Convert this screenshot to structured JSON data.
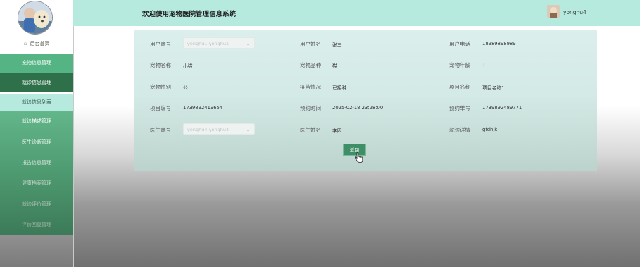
{
  "header": {
    "title": "欢迎使用宠物医院管理信息系统",
    "username": "yonghu4"
  },
  "sidebar": {
    "home": "后台首页",
    "menu": {
      "pet": "宠物信息管理",
      "visit": "就诊信息管理",
      "visit_list": "就诊信息列表",
      "desc": "就诊描述管理",
      "diag": "医生诊断管理",
      "report": "报告信息管理",
      "health": "健康档案管理",
      "eval": "就诊评价管理",
      "reply": "评价回复管理"
    }
  },
  "form": {
    "user_account": {
      "label": "用户账号",
      "value": "yonghu1-yonghu1"
    },
    "user_name": {
      "label": "用户姓名",
      "value": "张三"
    },
    "user_phone": {
      "label": "用户电话",
      "value": "18989898989"
    },
    "pet_name": {
      "label": "宠物名称",
      "value": "小猫"
    },
    "pet_breed": {
      "label": "宠物品种",
      "value": "猫"
    },
    "pet_age": {
      "label": "宠物年龄",
      "value": "1"
    },
    "pet_gender": {
      "label": "宠物性别",
      "value": "公"
    },
    "vaccine": {
      "label": "疫苗情况",
      "value": "已接种"
    },
    "item_name": {
      "label": "项目名称",
      "value": "项目名称1"
    },
    "item_no": {
      "label": "项目编号",
      "value": "1739892419654"
    },
    "appointment_time": {
      "label": "预约时间",
      "value": "2025-02-18 23:28:00"
    },
    "appointment_no": {
      "label": "预约单号",
      "value": "1739892489771"
    },
    "doctor_account": {
      "label": "医生账号",
      "value": "yonghu4-yonghu4"
    },
    "doctor_name": {
      "label": "医生姓名",
      "value": "李四"
    },
    "visit_detail": {
      "label": "就诊详情",
      "value": "gfdhjk"
    }
  },
  "actions": {
    "back": "返回"
  },
  "icons": {
    "home": "home-icon",
    "select": "chevron-down-icon",
    "cursor": "hand-pointer-icon"
  },
  "colors": {
    "header_bg": "#b6eadf",
    "menu_active": "#2e7049",
    "menu_green": "#55b484",
    "button": "#3e8f68"
  }
}
